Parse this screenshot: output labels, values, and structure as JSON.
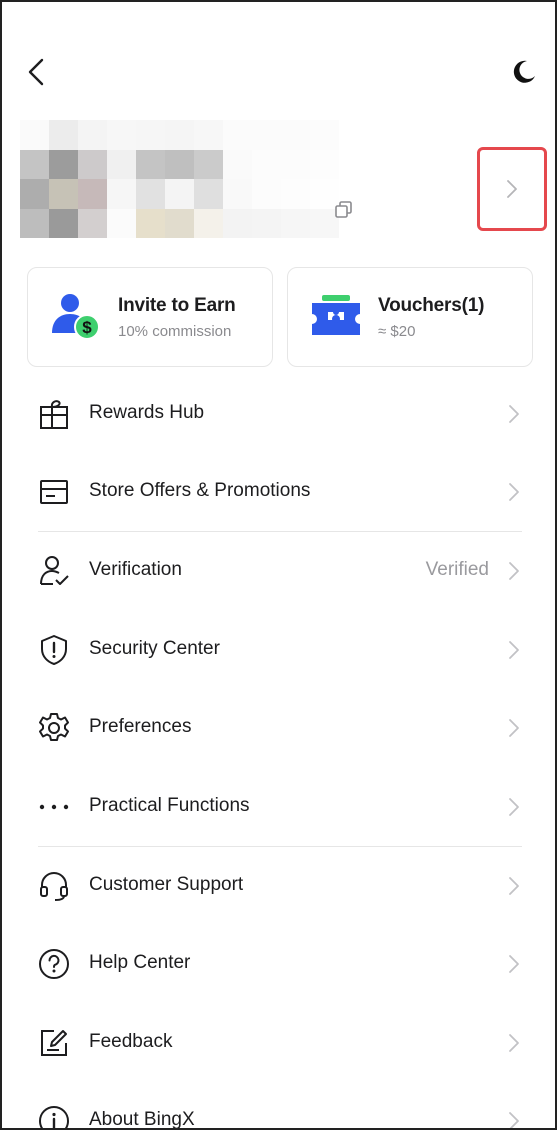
{
  "header": {
    "back_icon": "chevron-left-icon",
    "theme_icon": "moon-icon"
  },
  "profile": {
    "copy_icon": "copy-icon",
    "chevron_icon": "chevron-right-icon"
  },
  "cards": [
    {
      "title": "Invite to Earn",
      "subtitle": "10% commission",
      "icon": "user-dollar-icon",
      "color": "#2f5bea"
    },
    {
      "title": "Vouchers(1)",
      "subtitle": "≈ $20",
      "icon": "voucher-ticket-icon",
      "color": "#2f5bea"
    }
  ],
  "menu": [
    {
      "label": "Rewards Hub",
      "icon": "gift-icon",
      "value": ""
    },
    {
      "label": "Store Offers & Promotions",
      "icon": "store-icon",
      "value": ""
    },
    {
      "label": "Verification",
      "icon": "user-check-icon",
      "value": "Verified"
    },
    {
      "label": "Security Center",
      "icon": "shield-icon",
      "value": ""
    },
    {
      "label": "Preferences",
      "icon": "gear-icon",
      "value": ""
    },
    {
      "label": "Practical Functions",
      "icon": "more-dots-icon",
      "value": ""
    },
    {
      "label": "Customer Support",
      "icon": "headset-icon",
      "value": ""
    },
    {
      "label": "Help Center",
      "icon": "question-circle-icon",
      "value": ""
    },
    {
      "label": "Feedback",
      "icon": "edit-square-icon",
      "value": ""
    },
    {
      "label": "About BingX",
      "icon": "info-circle-icon",
      "value": ""
    }
  ],
  "colors": {
    "accent": "#2f5bea",
    "accent_green": "#3ecf6e",
    "highlight_border": "#e5484d",
    "muted_text": "#9a9a9e"
  }
}
